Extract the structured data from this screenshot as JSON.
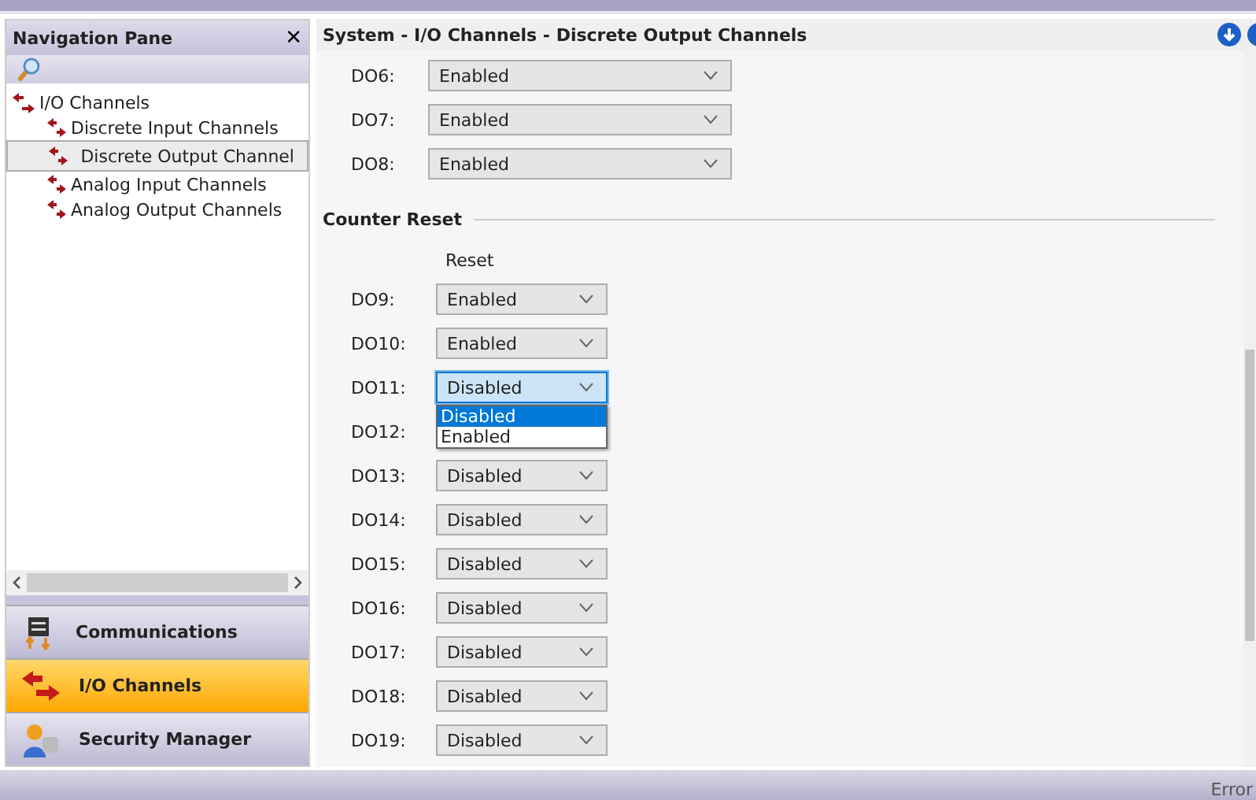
{
  "navigation_pane": {
    "title": "Navigation Pane",
    "close": "✕",
    "tree": [
      {
        "label": "I/O Channels",
        "selected": false,
        "children": [
          {
            "label": "Discrete Input Channels",
            "selected": false
          },
          {
            "label": "Discrete Output Channel",
            "selected": true
          },
          {
            "label": "Analog Input Channels",
            "selected": false
          },
          {
            "label": "Analog Output Channels",
            "selected": false
          }
        ]
      }
    ],
    "buttons": [
      {
        "label": "Communications",
        "kind": "comm",
        "selected": false
      },
      {
        "label": "I/O Channels",
        "kind": "io",
        "selected": true
      },
      {
        "label": "Security Manager",
        "kind": "security",
        "selected": false
      }
    ]
  },
  "content": {
    "title": "System - I/O Channels - Discrete Output Channels",
    "top_rows": [
      {
        "label": "DO6:",
        "value": "Enabled"
      },
      {
        "label": "DO7:",
        "value": "Enabled"
      },
      {
        "label": "DO8:",
        "value": "Enabled"
      }
    ],
    "group": {
      "title": "Counter Reset",
      "column": "Reset",
      "rows": [
        {
          "label": "DO9:",
          "value": "Enabled",
          "focused": false
        },
        {
          "label": "DO10:",
          "value": "Enabled",
          "focused": false
        },
        {
          "label": "DO11:",
          "value": "Disabled",
          "focused": true,
          "options": [
            {
              "label": "Disabled",
              "selected": true
            },
            {
              "label": "Enabled",
              "selected": false
            }
          ]
        },
        {
          "label": "DO12:"
        },
        {
          "label": "DO13:",
          "value": "Disabled",
          "focused": false
        },
        {
          "label": "DO14:",
          "value": "Disabled",
          "focused": false
        },
        {
          "label": "DO15:",
          "value": "Disabled",
          "focused": false
        },
        {
          "label": "DO16:",
          "value": "Disabled",
          "focused": false
        },
        {
          "label": "DO17:",
          "value": "Disabled",
          "focused": false
        },
        {
          "label": "DO18:",
          "value": "Disabled",
          "focused": false
        },
        {
          "label": "DO19:",
          "value": "Disabled",
          "focused": false
        }
      ]
    }
  },
  "status_bar": {
    "text": "Error"
  }
}
